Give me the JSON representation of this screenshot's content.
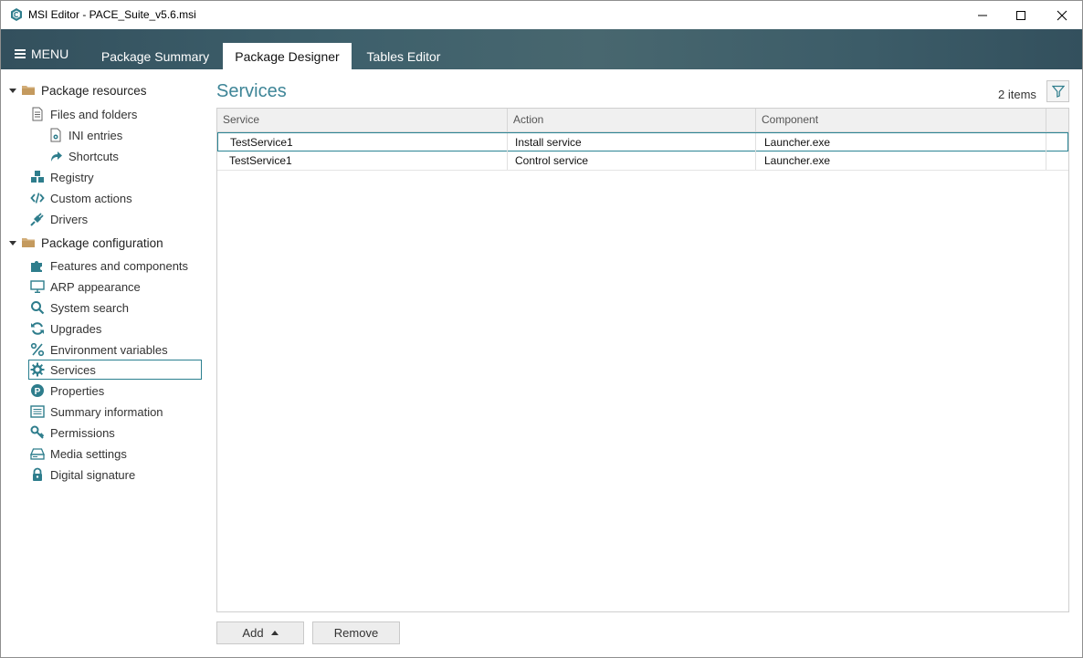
{
  "window": {
    "title": "MSI Editor - PACE_Suite_v5.6.msi"
  },
  "nav": {
    "menu_label": "MENU",
    "tabs": [
      {
        "label": "Package Summary",
        "active": false
      },
      {
        "label": "Package Designer",
        "active": true
      },
      {
        "label": "Tables Editor",
        "active": false
      }
    ]
  },
  "sidebar": {
    "groups": [
      {
        "label": "Package resources",
        "icon": "folder-icon",
        "items": [
          {
            "label": "Files and folders",
            "icon": "file-icon"
          },
          {
            "label": "INI entries",
            "icon": "ini-file-icon"
          },
          {
            "label": "Shortcuts",
            "icon": "shortcut-arrow-icon"
          },
          {
            "label": "Registry",
            "icon": "registry-cubes-icon"
          },
          {
            "label": "Custom actions",
            "icon": "code-brackets-icon"
          },
          {
            "label": "Drivers",
            "icon": "plug-icon"
          }
        ]
      },
      {
        "label": "Package configuration",
        "icon": "folder-icon",
        "items": [
          {
            "label": "Features and components",
            "icon": "puzzle-icon"
          },
          {
            "label": "ARP appearance",
            "icon": "monitor-icon"
          },
          {
            "label": "System search",
            "icon": "magnifier-icon"
          },
          {
            "label": "Upgrades",
            "icon": "refresh-icon"
          },
          {
            "label": "Environment variables",
            "icon": "percent-icon"
          },
          {
            "label": "Services",
            "icon": "gear-icon",
            "selected": true
          },
          {
            "label": "Properties",
            "icon": "p-circle-icon"
          },
          {
            "label": "Summary information",
            "icon": "list-icon"
          },
          {
            "label": "Permissions",
            "icon": "key-icon"
          },
          {
            "label": "Media settings",
            "icon": "drive-icon"
          },
          {
            "label": "Digital signature",
            "icon": "lock-icon"
          }
        ]
      }
    ]
  },
  "main": {
    "title": "Services",
    "items_count": "2 items",
    "columns": [
      "Service",
      "Action",
      "Component"
    ],
    "rows": [
      [
        "TestService1",
        "Install service",
        "Launcher.exe"
      ],
      [
        "TestService1",
        "Control service",
        "Launcher.exe"
      ]
    ],
    "add_label": "Add",
    "remove_label": "Remove"
  },
  "colors": {
    "accent": "#3e8597",
    "icon_teal": "#2e7d8c",
    "tab_band": "#3d5f6b",
    "folder": "#c9a16a"
  }
}
